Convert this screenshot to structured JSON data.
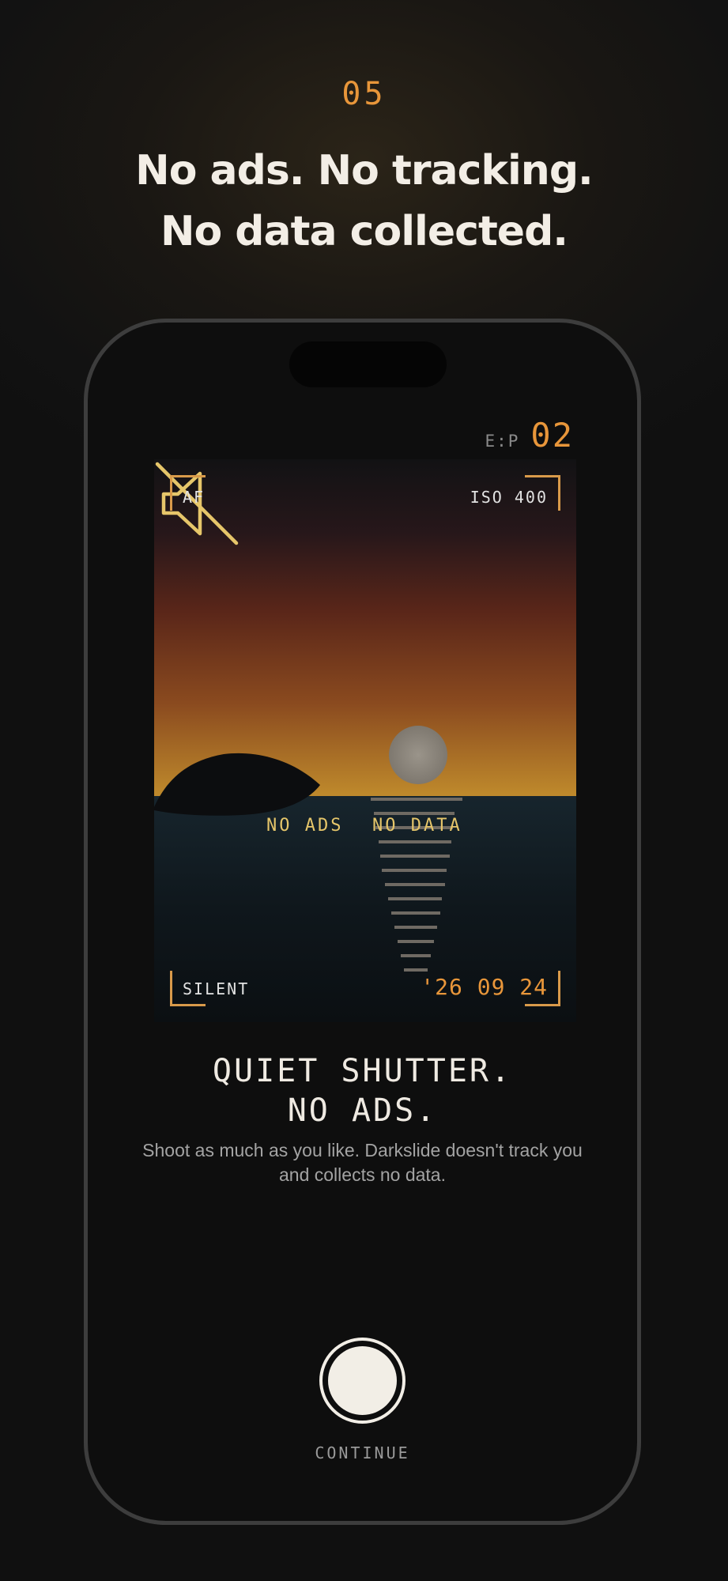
{
  "header": {
    "step_number": "05",
    "headline_line1": "No ads. No tracking.",
    "headline_line2": "No data collected."
  },
  "camera": {
    "exp_label": "E:P",
    "exp_value": "02",
    "focus_mode": "AF",
    "iso": "ISO 400",
    "mode": "SILENT",
    "date_stamp": "'26 09 24",
    "tag_left": "NO ADS",
    "tag_right": "NO DATA",
    "center_icon": "speaker-muted-icon"
  },
  "card": {
    "title_line1": "QUIET SHUTTER.",
    "title_line2": "NO ADS.",
    "description": "Shoot as much as you like. Darkslide doesn't track you and collects no data."
  },
  "actions": {
    "continue_label": "CONTINUE",
    "shutter_icon": "shutter-button-circle"
  },
  "colors": {
    "accent": "#e8963a",
    "tag_yellow": "#e6c66a",
    "bracket": "#d99a4a",
    "text_primary": "#f2ede4",
    "text_secondary": "#a3a3a3",
    "background": "#121212"
  }
}
